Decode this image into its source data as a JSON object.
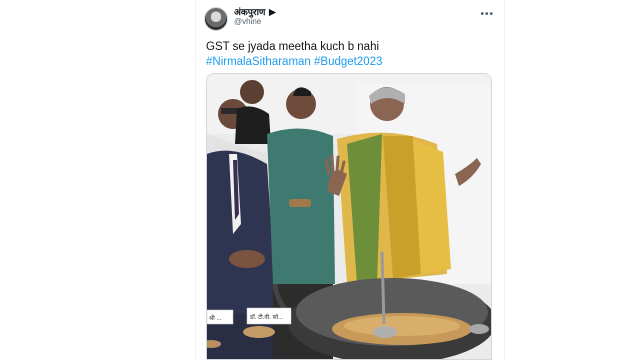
{
  "tweet": {
    "display_name": "अंकपुराण",
    "handle": "@vhine",
    "more_label": "•••",
    "text": "GST se jyada meetha kuch b nahi",
    "hashtags": "#NirmalaSitharaman #Budget2023"
  },
  "media": {
    "name_card_left": "श्री ...",
    "name_card_right": "डॉ. टी.वी. सो..."
  },
  "colors": {
    "link": "#1d9bf0",
    "text": "#0f1419",
    "secondary": "#536471"
  }
}
